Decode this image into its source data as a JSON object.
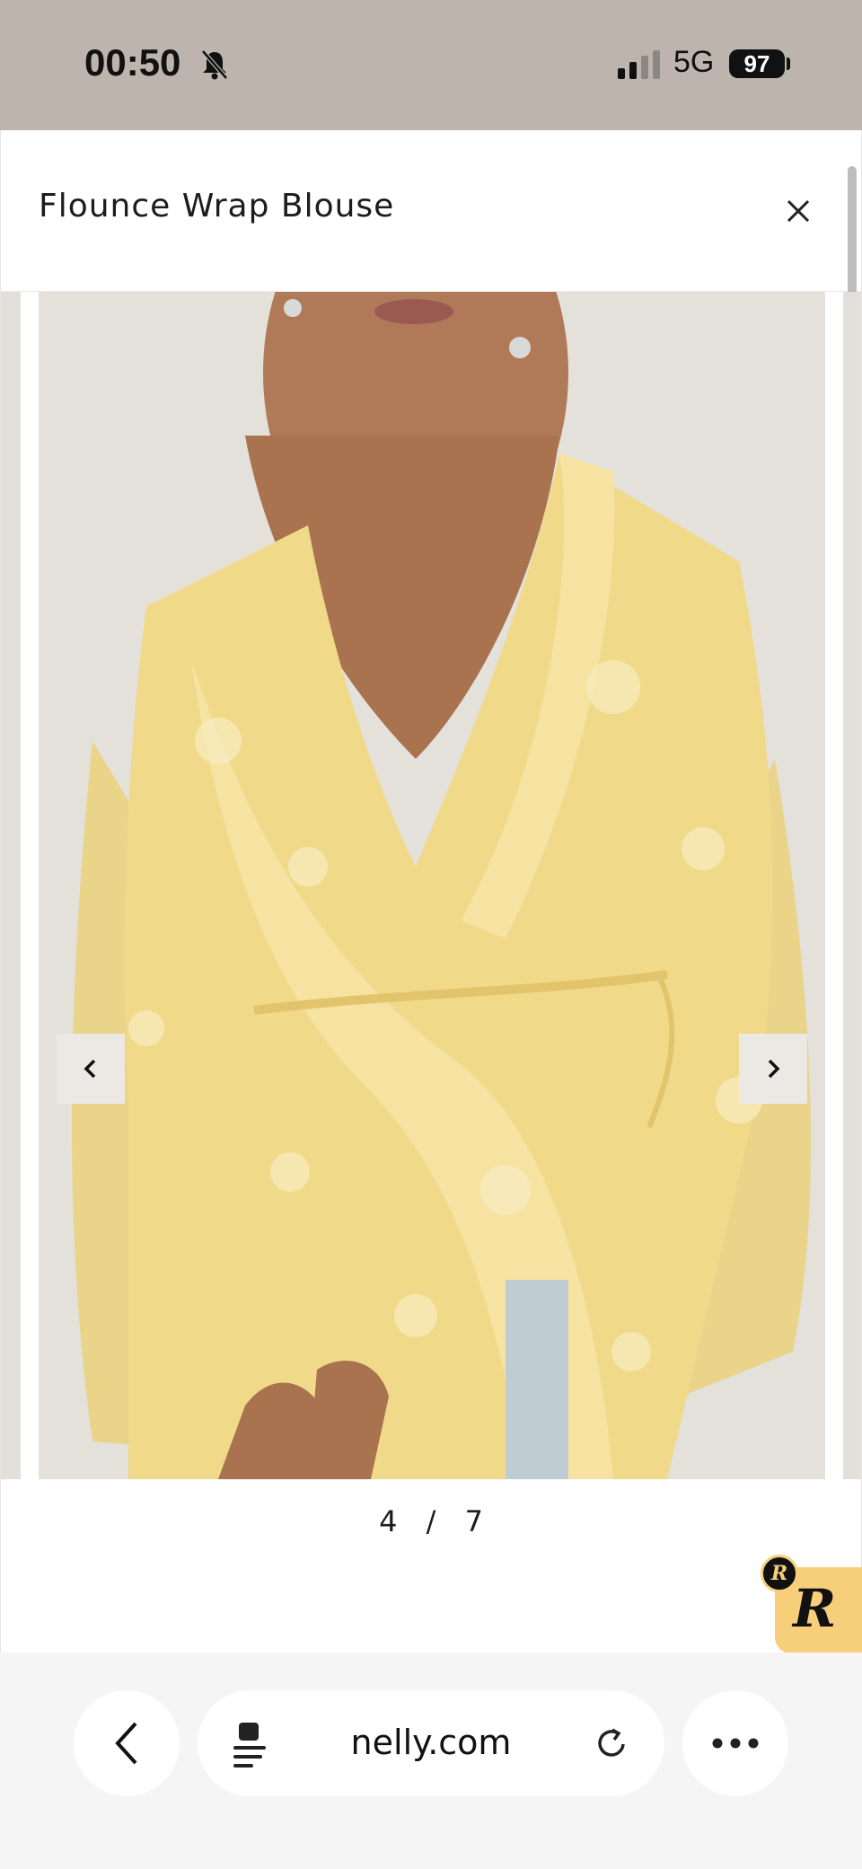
{
  "status_bar": {
    "time": "00:50",
    "network": "5G",
    "battery": "97"
  },
  "modal": {
    "title": "Flounce Wrap Blouse",
    "close_icon": "close-icon"
  },
  "gallery": {
    "current": "4",
    "separator": "/",
    "total": "7",
    "prev_icon": "chevron-left-icon",
    "next_icon": "chevron-right-icon"
  },
  "badge": {
    "letter": "R",
    "small_letter": "R",
    "color": "#f7cf7a"
  },
  "browser": {
    "url": "nelly.com",
    "back_icon": "chevron-left-icon",
    "page_icon": "page-settings-icon",
    "reload_icon": "reload-icon",
    "more_icon": "more-icon"
  },
  "colors": {
    "status_bar": "#bdb5ad",
    "blouse": "#f1d98a"
  }
}
